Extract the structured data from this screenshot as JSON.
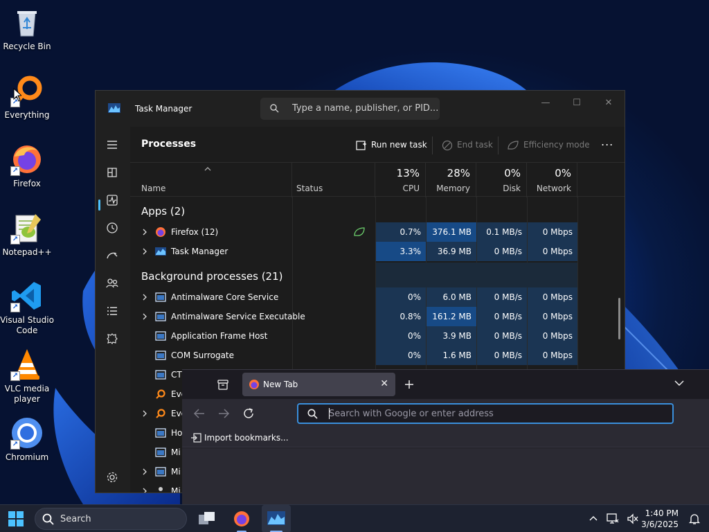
{
  "desktop": {
    "icons": [
      {
        "label": "Recycle Bin",
        "icon": "recycle-bin-icon"
      },
      {
        "label": "Everything",
        "icon": "everything-icon"
      },
      {
        "label": "Firefox",
        "icon": "firefox-icon"
      },
      {
        "label": "Notepad++",
        "icon": "notepad-plus-plus-icon"
      },
      {
        "label": "Visual Studio Code",
        "icon": "vscode-icon"
      },
      {
        "label": "VLC media player",
        "icon": "vlc-icon"
      },
      {
        "label": "Chromium",
        "icon": "chromium-icon"
      }
    ]
  },
  "task_manager": {
    "title": "Task Manager",
    "search_placeholder": "Type a name, publisher, or PID...",
    "page_title": "Processes",
    "toolbar": {
      "run_new_task": "Run new task",
      "end_task": "End task",
      "efficiency_mode": "Efficiency mode",
      "more": "..."
    },
    "columns": {
      "name": "Name",
      "status": "Status",
      "cpu_pct": "13%",
      "cpu": "CPU",
      "memory_pct": "28%",
      "memory": "Memory",
      "disk_pct": "0%",
      "disk": "Disk",
      "network_pct": "0%",
      "network": "Network"
    },
    "groups": {
      "apps": "Apps (2)",
      "background": "Background processes (21)"
    },
    "apps": [
      {
        "name": "Firefox (12)",
        "cpu": "0.7%",
        "memory": "376.1 MB",
        "disk": "0.1 MB/s",
        "network": "0 Mbps"
      },
      {
        "name": "Task Manager",
        "cpu": "3.3%",
        "memory": "36.9 MB",
        "disk": "0 MB/s",
        "network": "0 Mbps"
      }
    ],
    "background": [
      {
        "name": "Antimalware Core Service",
        "cpu": "0%",
        "memory": "6.0 MB",
        "disk": "0 MB/s",
        "network": "0 Mbps"
      },
      {
        "name": "Antimalware Service Executable",
        "cpu": "0.8%",
        "memory": "161.2 MB",
        "disk": "0 MB/s",
        "network": "0 Mbps"
      },
      {
        "name": "Application Frame Host",
        "cpu": "0%",
        "memory": "3.9 MB",
        "disk": "0 MB/s",
        "network": "0 Mbps"
      },
      {
        "name": "COM Surrogate",
        "cpu": "0%",
        "memory": "1.6 MB",
        "disk": "0 MB/s",
        "network": "0 Mbps"
      },
      {
        "name": "CTI"
      },
      {
        "name": "Eve"
      },
      {
        "name": "Eve"
      },
      {
        "name": "Ho"
      },
      {
        "name": "Mi"
      },
      {
        "name": "Mi"
      },
      {
        "name": "Mi"
      }
    ]
  },
  "firefox": {
    "tab_label": "New Tab",
    "url_placeholder": "Search with Google or enter address",
    "import_bookmarks": "Import bookmarks..."
  },
  "taskbar": {
    "search_label": "Search",
    "time": "1:40 PM",
    "date": "3/6/2025"
  },
  "colors": {
    "accent": "#4cc2ff",
    "cell_heat_low": "#1b3553",
    "cell_heat_high": "#174a86",
    "firefox_focus": "#3a8fdc"
  }
}
